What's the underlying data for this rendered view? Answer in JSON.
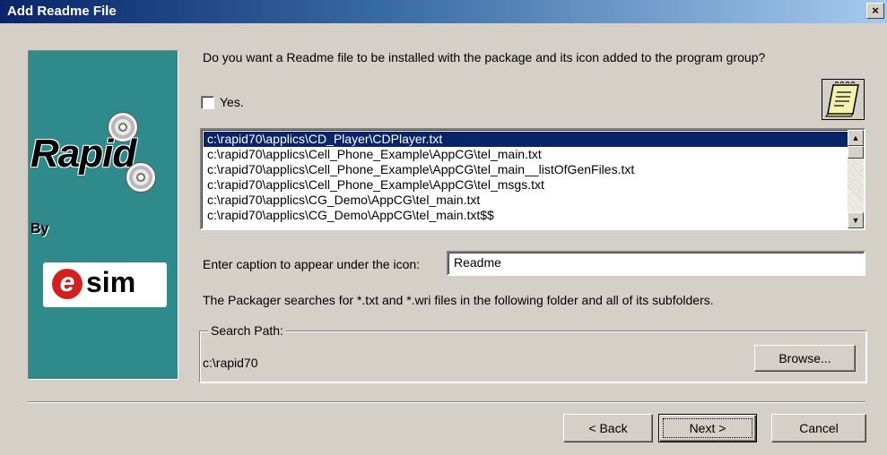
{
  "window": {
    "title": "Add Readme File",
    "close_label": "×"
  },
  "side_panel": {
    "brand": "Rapid",
    "by_label": "By",
    "logo_e": "e",
    "logo_sim": "sim"
  },
  "main": {
    "question": "Do you want a Readme file to be installed with the package and its icon added to the program group?",
    "checkbox": {
      "label": "Yes.",
      "checked": false
    },
    "readme_icon": "notepad-icon",
    "files": [
      "c:\\rapid70\\applics\\CD_Player\\CDPlayer.txt",
      "c:\\rapid70\\applics\\Cell_Phone_Example\\AppCG\\tel_main.txt",
      "c:\\rapid70\\applics\\Cell_Phone_Example\\AppCG\\tel_main__listOfGenFiles.txt",
      "c:\\rapid70\\applics\\Cell_Phone_Example\\AppCG\\tel_msgs.txt",
      "c:\\rapid70\\applics\\CG_Demo\\AppCG\\tel_main.txt",
      "c:\\rapid70\\applics\\CG_Demo\\AppCG\\tel_main.txt$$"
    ],
    "selected_index": 0,
    "caption_label": "Enter caption to appear under the icon:",
    "caption_value": "Readme",
    "packager_note": "The Packager searches for *.txt and *.wri files in the following folder and all of its subfolders.",
    "search_path": {
      "group_label": "Search Path:",
      "value": "c:\\rapid70",
      "browse_label": "Browse..."
    }
  },
  "footer": {
    "back_label": "< Back",
    "next_label": "Next >",
    "cancel_label": "Cancel"
  }
}
